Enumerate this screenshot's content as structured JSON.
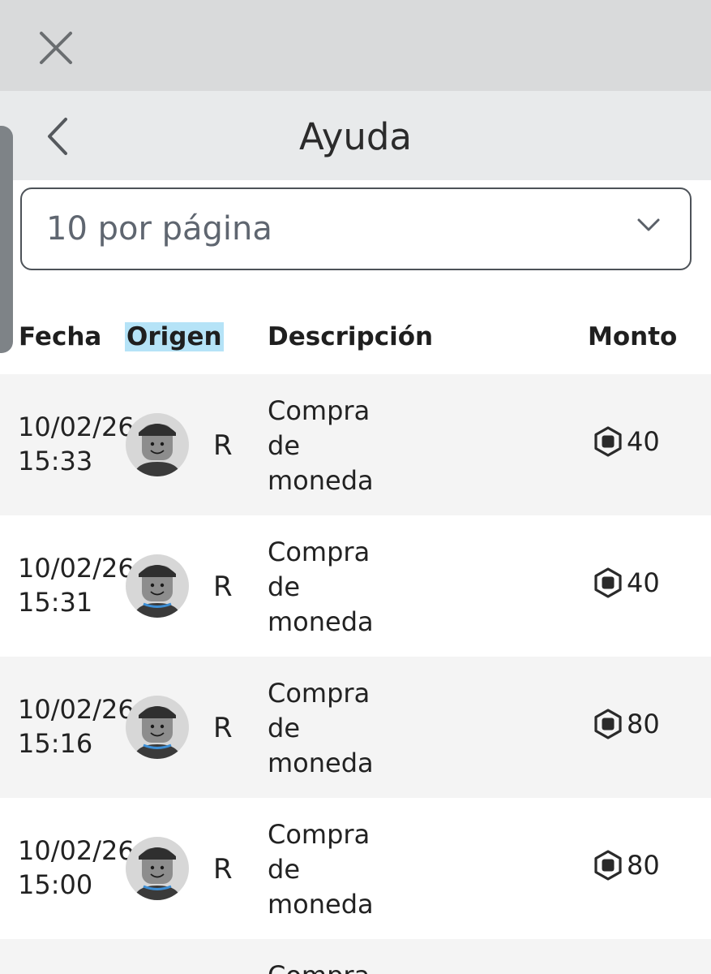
{
  "header": {
    "title": "Ayuda"
  },
  "pagination": {
    "selected": "10 por página"
  },
  "table": {
    "headers": {
      "date": "Fecha",
      "origin": "Origen",
      "description": "Descripción",
      "amount": "Monto"
    },
    "rows": [
      {
        "date": "10/02/26",
        "time": "15:33",
        "origin": "R",
        "desc": [
          "Compra",
          "de",
          "moneda"
        ],
        "amount": "40"
      },
      {
        "date": "10/02/26",
        "time": "15:31",
        "origin": "R",
        "desc": [
          "Compra",
          "de",
          "moneda"
        ],
        "amount": "40"
      },
      {
        "date": "10/02/26",
        "time": "15:16",
        "origin": "R",
        "desc": [
          "Compra",
          "de",
          "moneda"
        ],
        "amount": "80"
      },
      {
        "date": "10/02/26",
        "time": "15:00",
        "origin": "R",
        "desc": [
          "Compra",
          "de",
          "moneda"
        ],
        "amount": "80"
      }
    ],
    "partial_row": {
      "desc": "Compra"
    }
  },
  "icons": {
    "close": "close-icon",
    "back": "chevron-left-icon",
    "dropdown": "chevron-down-icon",
    "currency": "robux-icon"
  },
  "colors": {
    "topbar": "#d9dadb",
    "header": "#e8eaeb",
    "highlight": "#b5e3f7",
    "row_alt": "#f4f4f4"
  }
}
